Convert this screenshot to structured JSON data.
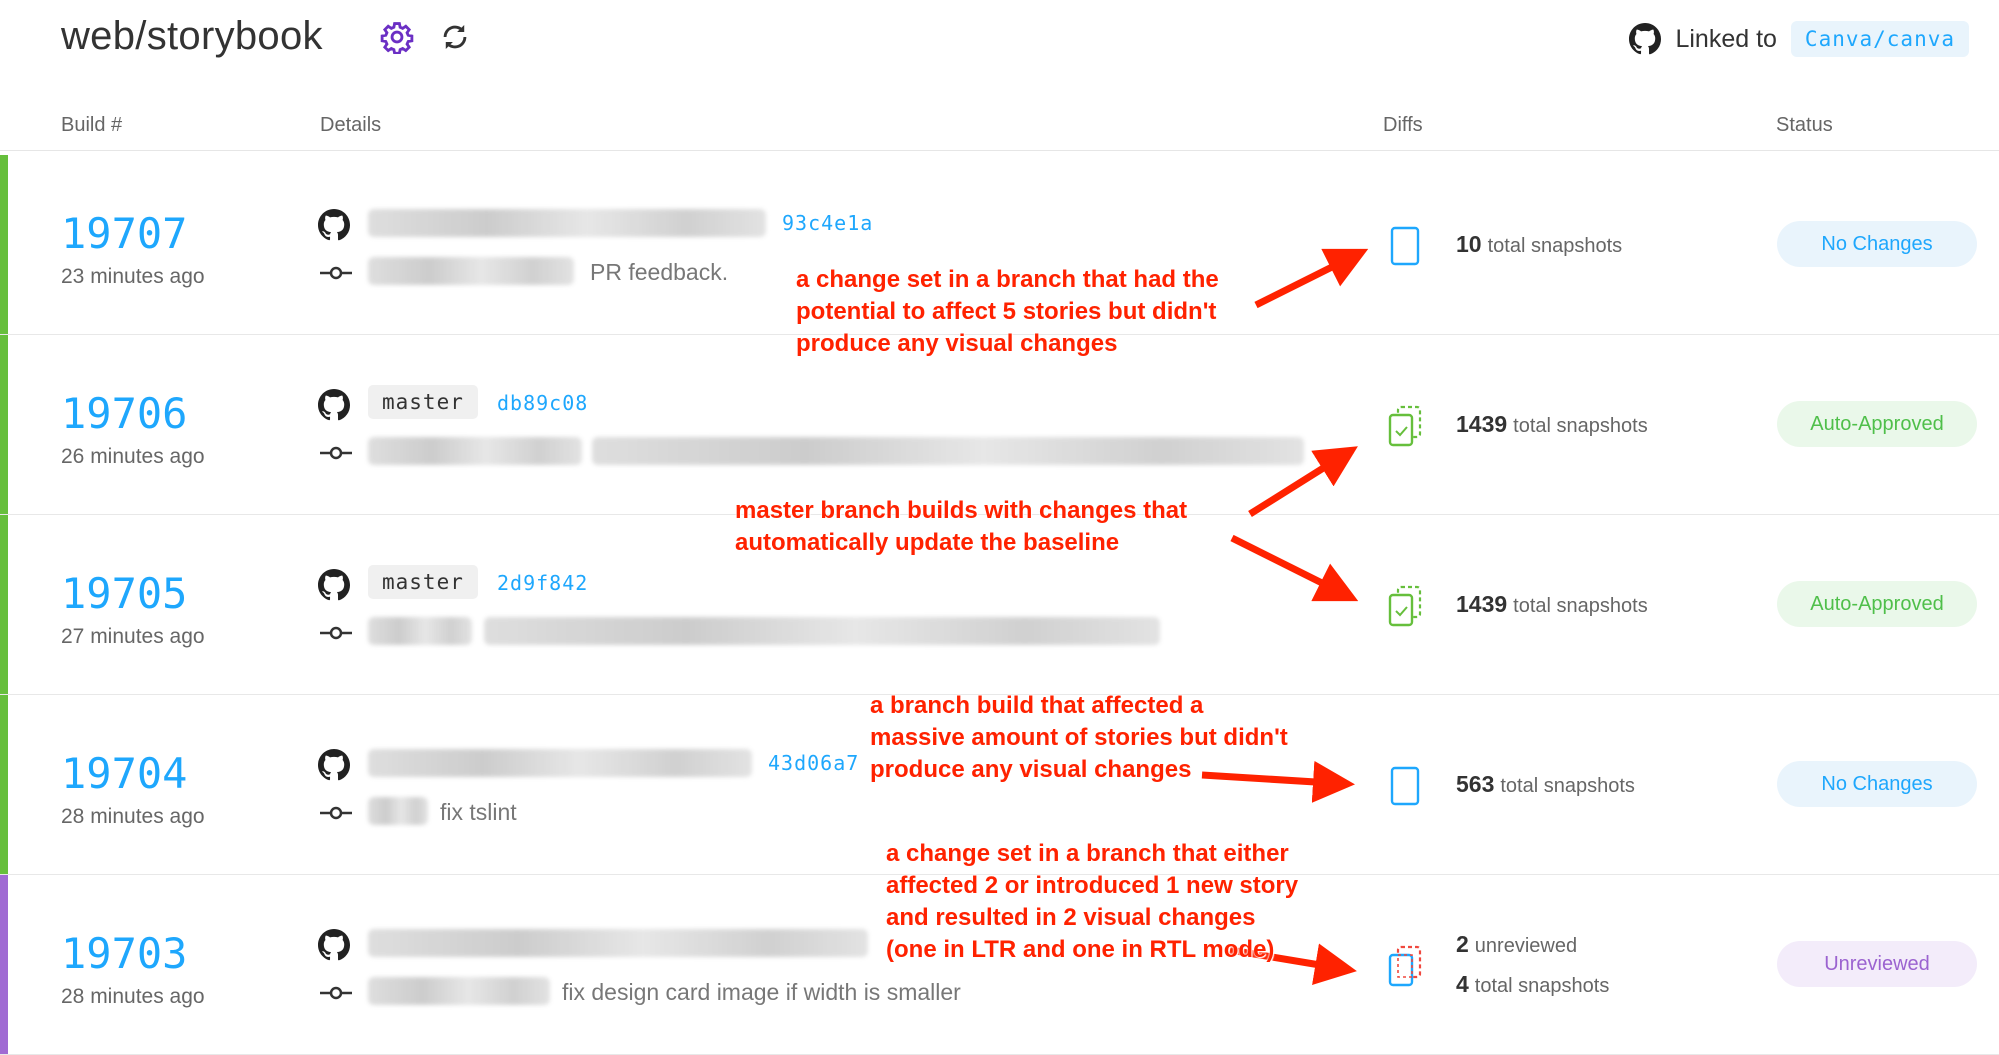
{
  "header": {
    "title": "web/storybook",
    "linked_label": "Linked to",
    "repo": "Canva/canva"
  },
  "columns": {
    "build": "Build #",
    "details": "Details",
    "diffs": "Diffs",
    "status": "Status"
  },
  "builds": [
    {
      "number": "19707",
      "time": "23 minutes ago",
      "branch": "",
      "sha": "93c4e1a",
      "message": "PR feedback.",
      "unreviewed": "",
      "unreviewed_label": "",
      "snapshots": "10",
      "snapshots_label": "total snapshots",
      "status": "No Changes"
    },
    {
      "number": "19706",
      "time": "26 minutes ago",
      "branch": "master",
      "sha": "db89c08",
      "message": "",
      "unreviewed": "",
      "unreviewed_label": "",
      "snapshots": "1439",
      "snapshots_label": "total snapshots",
      "status": "Auto-Approved"
    },
    {
      "number": "19705",
      "time": "27 minutes ago",
      "branch": "master",
      "sha": "2d9f842",
      "message": "",
      "unreviewed": "",
      "unreviewed_label": "",
      "snapshots": "1439",
      "snapshots_label": "total snapshots",
      "status": "Auto-Approved"
    },
    {
      "number": "19704",
      "time": "28 minutes ago",
      "branch": "",
      "sha": "43d06a7",
      "message": "fix tslint",
      "unreviewed": "",
      "unreviewed_label": "",
      "snapshots": "563",
      "snapshots_label": "total snapshots",
      "status": "No Changes"
    },
    {
      "number": "19703",
      "time": "28 minutes ago",
      "branch": "",
      "sha": "",
      "message": "fix design card image if width is smaller",
      "unreviewed": "2",
      "unreviewed_label": "unreviewed",
      "snapshots": "4",
      "snapshots_label": "total snapshots",
      "status": "Unreviewed"
    }
  ],
  "annotations": [
    [
      "a change set in a branch that had the",
      "potential to affect 5 stories but didn't",
      "produce any visual changes"
    ],
    [
      "master branch builds with changes that",
      "automatically update the baseline"
    ],
    [
      "a branch build that affected a",
      "massive amount of stories but didn't",
      "produce any visual changes"
    ],
    [
      "a change set in a branch that either",
      "affected 2 or introduced 1 new story",
      "and resulted in 2 visual changes",
      "(one in LTR and one in RTL mode)"
    ]
  ],
  "colors": {
    "accent": "#1ea7fd",
    "bar_green": "#66bf3c",
    "bar_purple": "#a06bd3",
    "status_no_changes_bg": "#e9f4fc",
    "status_auto_bg": "#eaf8ea",
    "status_unreviewed_bg": "#f3ecfa",
    "annotation": "#ff2200"
  },
  "icons": {
    "settings": "gear-icon",
    "refresh": "refresh-icon",
    "github": "github-icon",
    "commit": "commit-icon",
    "diff_none": "snapshot-blue-icon",
    "diff_auto": "snapshot-stack-green-icon",
    "diff_unreviewed": "snapshot-stack-red-icon"
  }
}
